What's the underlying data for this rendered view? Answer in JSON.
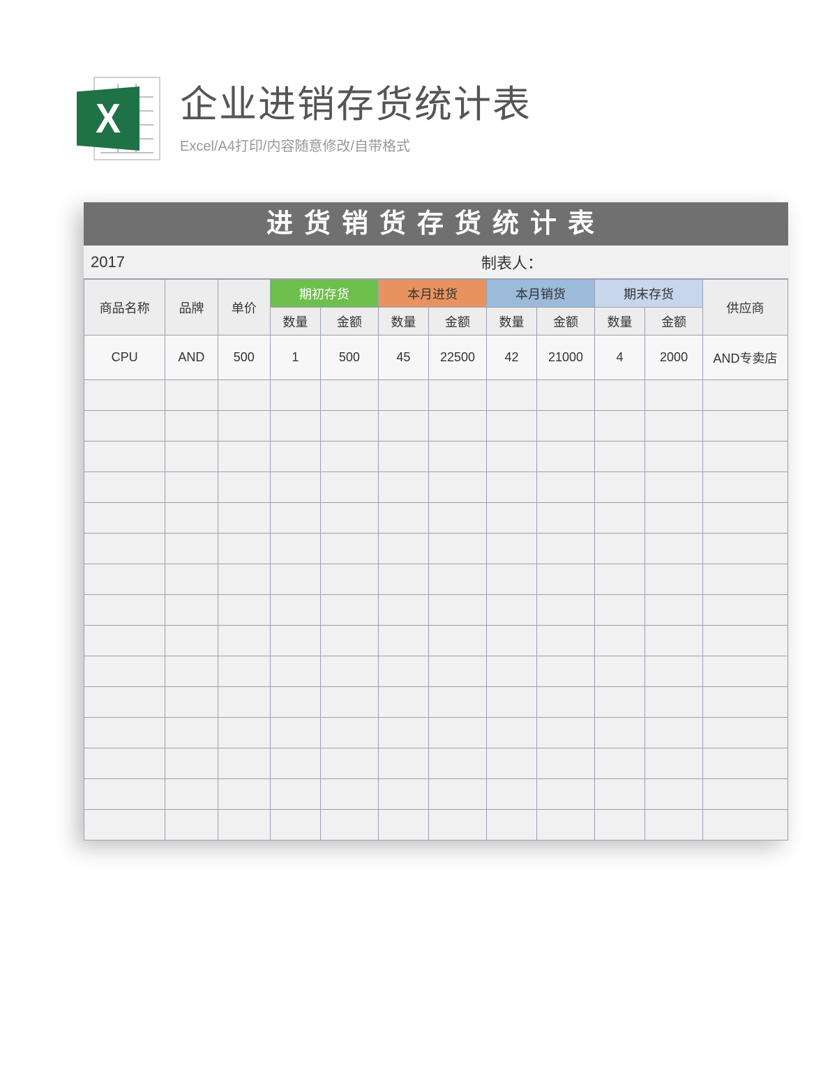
{
  "header": {
    "title": "企业进销存货统计表",
    "subtitle": "Excel/A4打印/内容随意修改/自带格式",
    "icon_letter": "X"
  },
  "sheet": {
    "title": "进货销货存货统计表",
    "year": "2017",
    "author_label": "制表人：",
    "columns": {
      "name": "商品名称",
      "brand": "品牌",
      "price": "单价",
      "groups": [
        {
          "label": "期初存货",
          "class": "grp-green"
        },
        {
          "label": "本月进货",
          "class": "grp-orange"
        },
        {
          "label": "本月销货",
          "class": "grp-blue"
        },
        {
          "label": "期末存货",
          "class": "grp-light"
        }
      ],
      "sub_qty": "数量",
      "sub_amt": "金额",
      "supplier": "供应商"
    },
    "rows": [
      {
        "name": "CPU",
        "brand": "AND",
        "price": "500",
        "g0_qty": "1",
        "g0_amt": "500",
        "g1_qty": "45",
        "g1_amt": "22500",
        "g2_qty": "42",
        "g2_amt": "21000",
        "g3_qty": "4",
        "g3_amt": "2000",
        "supplier": "AND专卖店"
      },
      {},
      {},
      {},
      {},
      {},
      {},
      {},
      {},
      {},
      {},
      {},
      {},
      {},
      {},
      {}
    ]
  }
}
